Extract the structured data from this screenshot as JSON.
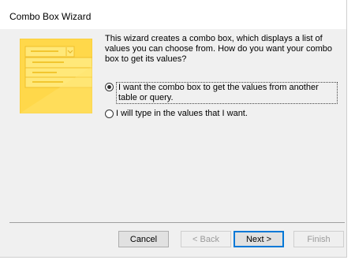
{
  "window": {
    "title": "Combo Box Wizard"
  },
  "illustration": {
    "icon": "combo-box-wizard-illustration",
    "accent_color": "#ffd84a"
  },
  "main": {
    "description": "This wizard creates a combo box, which displays a list of values you can choose from.  How do you want your combo box to get its values?",
    "options": [
      {
        "label": "I want the combo box to get the values from another table or query.",
        "selected": true
      },
      {
        "label": "I will type in the values that I want.",
        "selected": false
      }
    ]
  },
  "buttons": {
    "cancel": "Cancel",
    "back": "< Back",
    "next": "Next >",
    "finish": "Finish"
  },
  "colors": {
    "dialog_background": "#f0f0f0",
    "title_background": "#ffffff",
    "default_button_border": "#0078d7"
  }
}
